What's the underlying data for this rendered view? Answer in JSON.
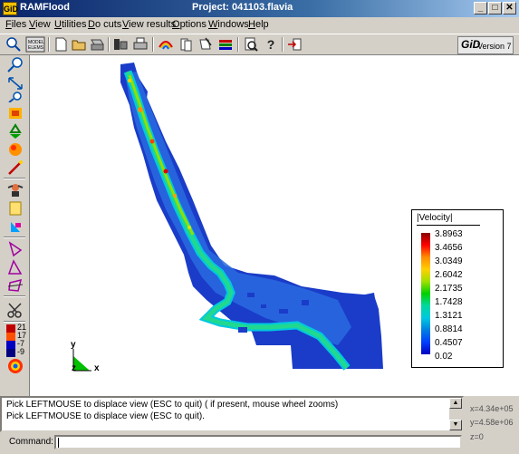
{
  "window": {
    "app_icon_text": "GiD",
    "app_title": "RAMFlood",
    "project_title": "Project: 041103.flavia",
    "minimize": "_",
    "maximize": "□",
    "close": "✕"
  },
  "menu": {
    "items": [
      "Files",
      "View",
      "Utilities",
      "Do cuts",
      "View results",
      "Options",
      "Windows",
      "Help"
    ]
  },
  "toolbar": {
    "icons": [
      "new-icon",
      "open-icon",
      "save-icon",
      "print-icon",
      "printer-icon",
      "rainbow-icon",
      "pages-icon",
      "notes-icon",
      "books-icon",
      "search-doc-icon",
      "help-icon",
      "exit-icon"
    ],
    "logo_mark": "GiD",
    "logo_version": "Version 7"
  },
  "left_toolbar": {
    "icons": [
      "zoom-in-icon",
      "zoom-out-icon",
      "pan-icon",
      "rotate-icon",
      "recycle-icon",
      "light-icon",
      "wand-icon",
      "person-icon",
      "note-icon",
      "vector-icon",
      "triangle-icon",
      "shape-icon",
      "shape-alt-icon",
      "scissors-icon",
      "color-scale-icon",
      "starburst-icon"
    ],
    "scale_values": [
      "21",
      "17",
      "-7",
      "-9"
    ]
  },
  "legend": {
    "title": "|Velocity|",
    "values": [
      "3.8963",
      "3.4656",
      "3.0349",
      "2.6042",
      "2.1735",
      "1.7428",
      "1.3121",
      "0.8814",
      "0.4507",
      "0.02"
    ]
  },
  "axes": {
    "y_label": "y",
    "z_label": "z",
    "x_label": "x"
  },
  "console": {
    "lines": [
      "Pick LEFTMOUSE to displace view (ESC to quit) ( if present, mouse wheel zooms)",
      "Pick LEFTMOUSE to displace view (ESC to quit)."
    ]
  },
  "coords": {
    "x": "x=4.34e+05",
    "y": "y=4.58e+06",
    "z": "z=0"
  },
  "command": {
    "label": "Command:",
    "value": ""
  },
  "colors": {
    "titlebar_start": "#0a246a",
    "chrome": "#d4d0c8",
    "river_base": "#1a3cc8"
  }
}
